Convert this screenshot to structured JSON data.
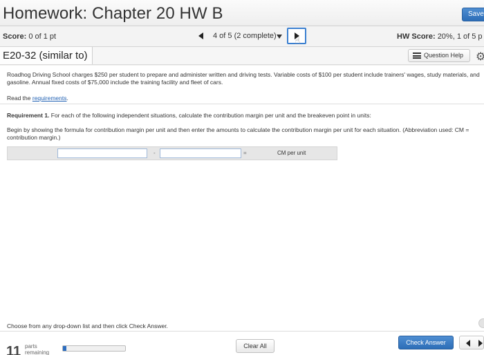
{
  "header": {
    "title": "Homework: Chapter 20 HW B",
    "save_label": "Save"
  },
  "scorebar": {
    "score_label": "Score:",
    "score_value": "0 of 1 pt",
    "progress_text": "4 of 5 (2 complete)",
    "hw_score_label": "HW Score:",
    "hw_score_value": "20%, 1 of 5 p"
  },
  "question": {
    "title": "E20-32 (similar to)",
    "help_label": "Question Help"
  },
  "content": {
    "problem_text": "Roadhog Driving School charges $250 per student to prepare and administer written and driving tests. Variable costs of $100 per student include trainers' wages, study materials, and gasoline. Annual fixed costs of $75,000 include the training facility and fleet of cars.",
    "read_prefix": "Read the ",
    "requirements_link": "requirements",
    "read_suffix": ".",
    "req_bold": "Requirement 1.",
    "req_text": " For each of the following independent situations, calculate the contribution margin per unit and the breakeven point in units:",
    "instruction_text": "Begin by showing the formula for contribution margin per unit and then enter the amounts to calculate the contribution margin per unit for each situation. (Abbreviation used: CM = contribution margin.)",
    "calc": {
      "operator": "-",
      "equals": "=",
      "result_label": "CM per unit",
      "input1_value": "",
      "input2_value": ""
    },
    "footer_instruction": "Choose from any drop-down list and then click Check Answer."
  },
  "footer": {
    "parts_count": "11",
    "parts_label": "parts remaining",
    "parts_progress": 0.05,
    "clear_all_label": "Clear All",
    "check_answer_label": "Check Answer"
  },
  "colors": {
    "accent": "#2c6db7",
    "link": "#2463b4"
  }
}
